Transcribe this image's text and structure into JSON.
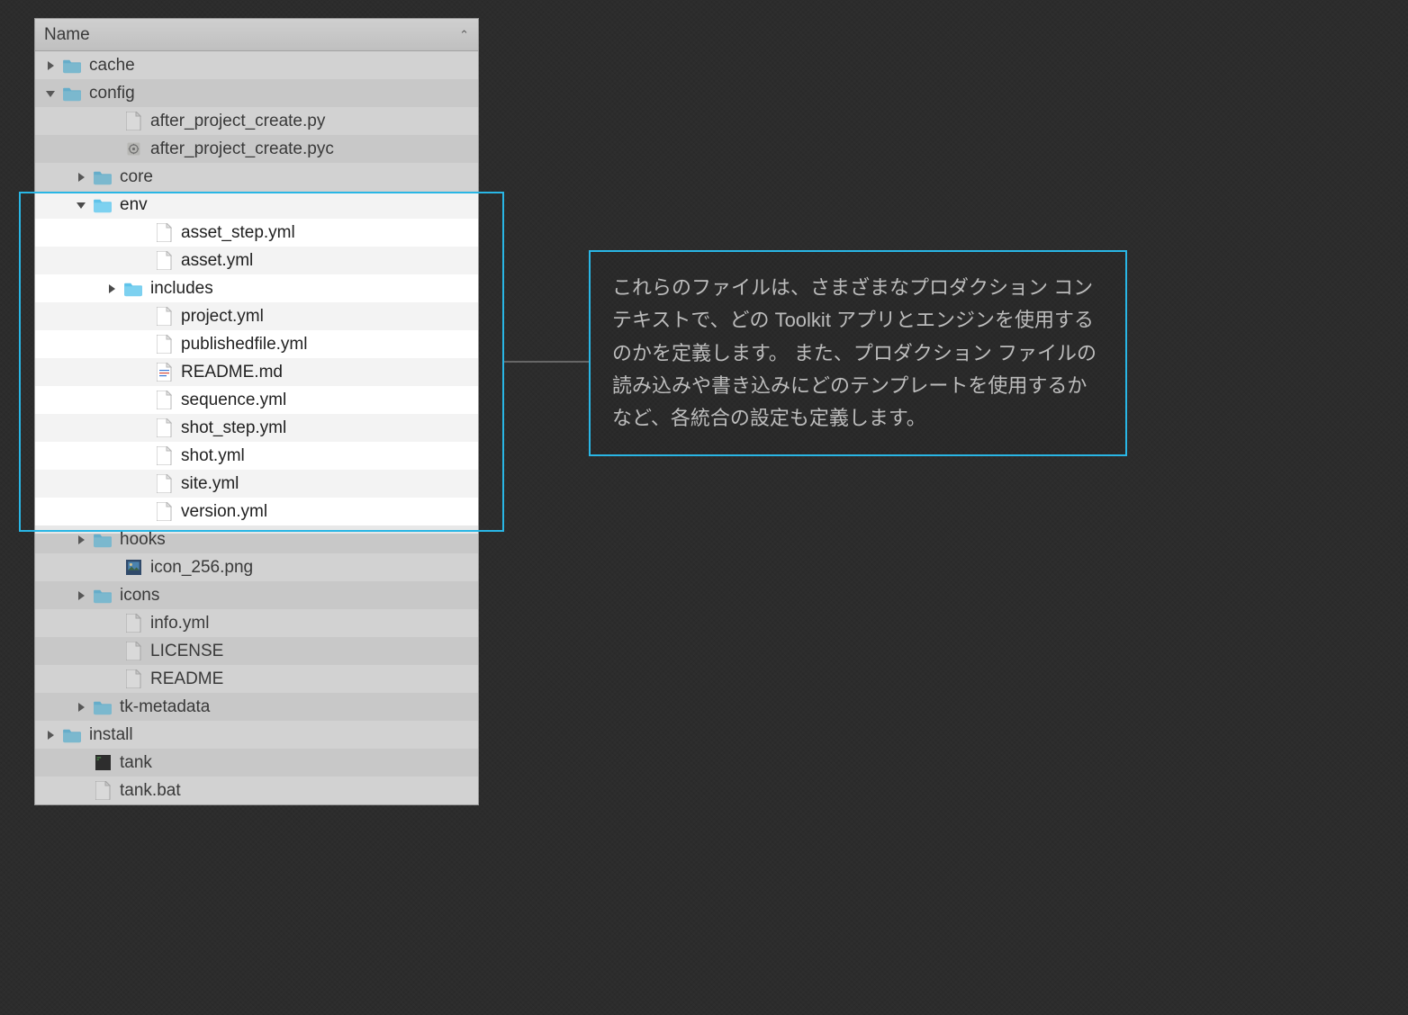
{
  "header": {
    "label": "Name",
    "sort_indicator": "⌃"
  },
  "callout": {
    "text": "これらのファイルは、さまざまなプロダクション コンテキストで、どの Toolkit アプリとエンジンを使用するのかを定義します。 また、プロダクション ファイルの読み込みや書き込みにどのテンプレートを使用するかなど、各統合の設定も定義します。"
  },
  "tree": [
    {
      "name": "cache",
      "type": "folder",
      "indent": 0,
      "expanded": false,
      "disclosure": true,
      "hl": false
    },
    {
      "name": "config",
      "type": "folder",
      "indent": 0,
      "expanded": true,
      "disclosure": true,
      "hl": false
    },
    {
      "name": "after_project_create.py",
      "type": "file",
      "indent": 2,
      "hl": false
    },
    {
      "name": "after_project_create.pyc",
      "type": "pyc",
      "indent": 2,
      "hl": false
    },
    {
      "name": "core",
      "type": "folder",
      "indent": 1,
      "expanded": false,
      "disclosure": true,
      "hl": false
    },
    {
      "name": "env",
      "type": "folder",
      "indent": 1,
      "expanded": true,
      "disclosure": true,
      "hl": true
    },
    {
      "name": "asset_step.yml",
      "type": "file",
      "indent": 3,
      "hl": true
    },
    {
      "name": "asset.yml",
      "type": "file",
      "indent": 3,
      "hl": true
    },
    {
      "name": "includes",
      "type": "folder",
      "indent": 2,
      "expanded": false,
      "disclosure": true,
      "hl": true
    },
    {
      "name": "project.yml",
      "type": "file",
      "indent": 3,
      "hl": true
    },
    {
      "name": "publishedfile.yml",
      "type": "file",
      "indent": 3,
      "hl": true
    },
    {
      "name": "README.md",
      "type": "md",
      "indent": 3,
      "hl": true
    },
    {
      "name": "sequence.yml",
      "type": "file",
      "indent": 3,
      "hl": true
    },
    {
      "name": "shot_step.yml",
      "type": "file",
      "indent": 3,
      "hl": true
    },
    {
      "name": "shot.yml",
      "type": "file",
      "indent": 3,
      "hl": true
    },
    {
      "name": "site.yml",
      "type": "file",
      "indent": 3,
      "hl": true
    },
    {
      "name": "version.yml",
      "type": "file",
      "indent": 3,
      "hl": true
    },
    {
      "name": "hooks",
      "type": "folder",
      "indent": 1,
      "expanded": false,
      "disclosure": true,
      "hl": false
    },
    {
      "name": "icon_256.png",
      "type": "png",
      "indent": 2,
      "hl": false
    },
    {
      "name": "icons",
      "type": "folder",
      "indent": 1,
      "expanded": false,
      "disclosure": true,
      "hl": false
    },
    {
      "name": "info.yml",
      "type": "file",
      "indent": 2,
      "hl": false
    },
    {
      "name": "LICENSE",
      "type": "file",
      "indent": 2,
      "hl": false
    },
    {
      "name": "README",
      "type": "file",
      "indent": 2,
      "hl": false
    },
    {
      "name": "tk-metadata",
      "type": "folder",
      "indent": 1,
      "expanded": false,
      "disclosure": true,
      "hl": false
    },
    {
      "name": "install",
      "type": "folder",
      "indent": 0,
      "expanded": false,
      "disclosure": true,
      "hl": false
    },
    {
      "name": "tank",
      "type": "exec",
      "indent": 1,
      "hl": false
    },
    {
      "name": "tank.bat",
      "type": "file",
      "indent": 1,
      "hl": false
    }
  ]
}
